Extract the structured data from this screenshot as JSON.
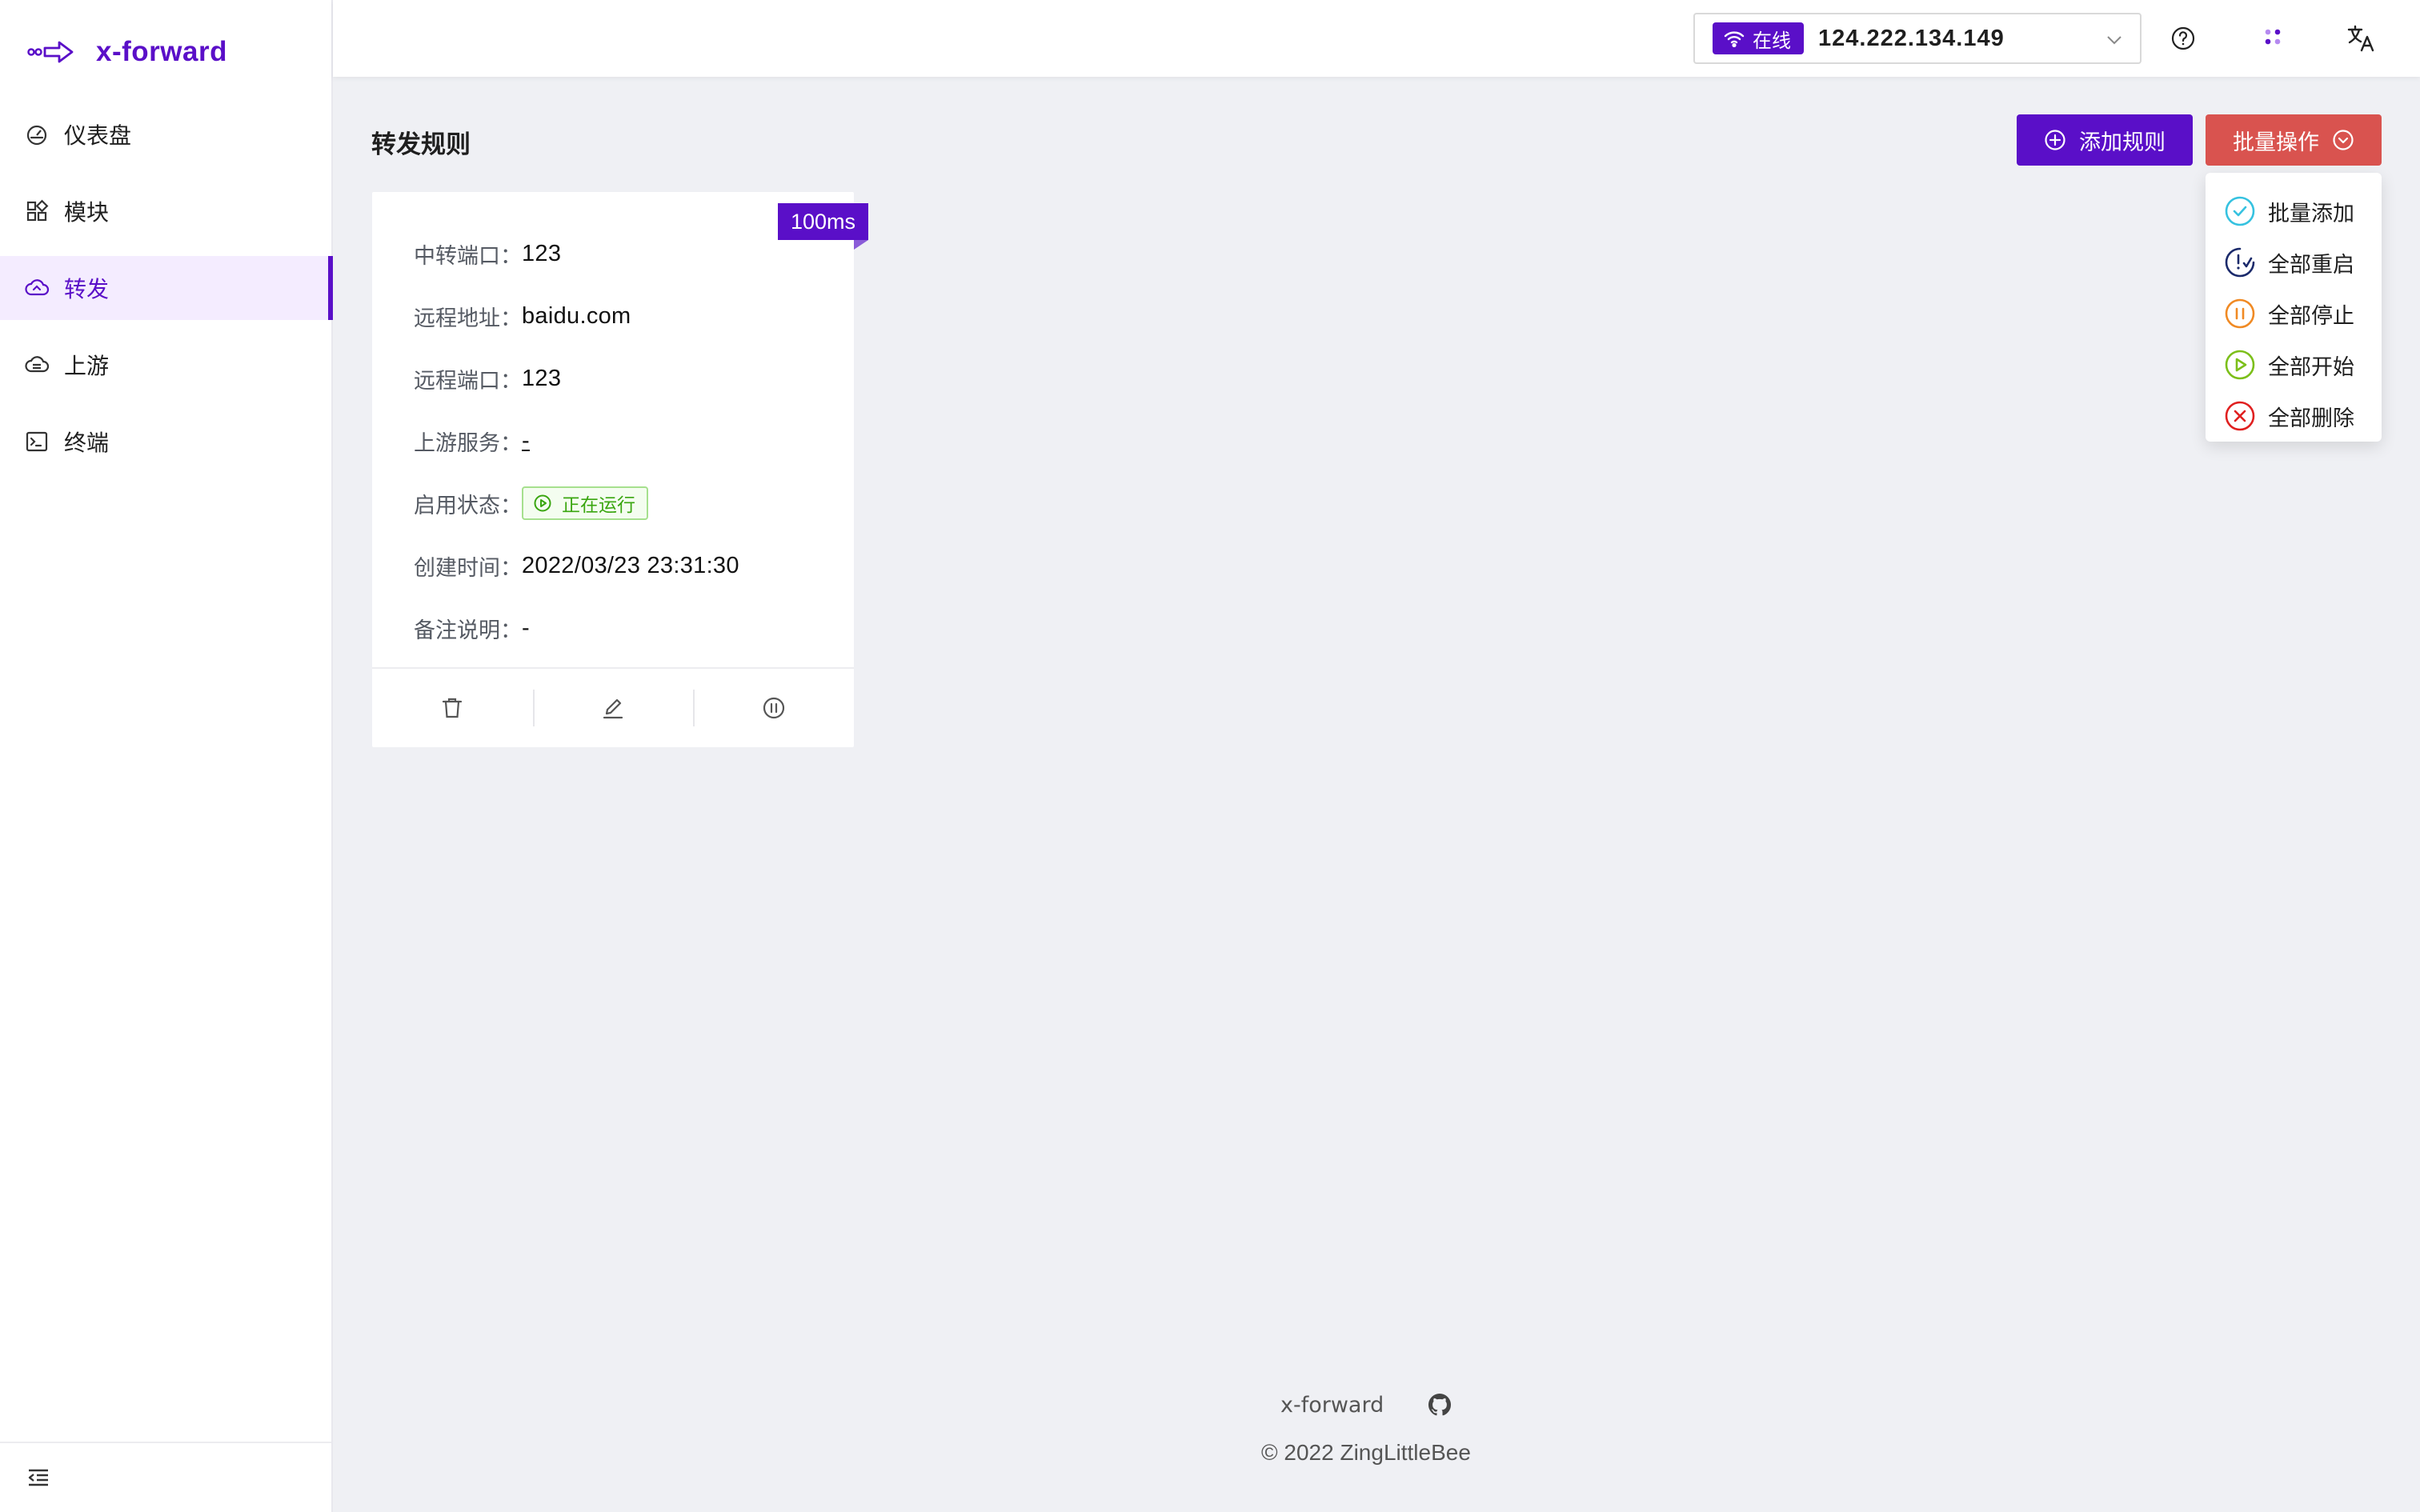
{
  "app": {
    "brand_name": "x-forward"
  },
  "sidebar": {
    "items": [
      {
        "label": "仪表盘",
        "icon": "dashboard-icon",
        "active": false
      },
      {
        "label": "模块",
        "icon": "modules-icon",
        "active": false
      },
      {
        "label": "转发",
        "icon": "forward-icon",
        "active": true
      },
      {
        "label": "上游",
        "icon": "upstream-icon",
        "active": false
      },
      {
        "label": "终端",
        "icon": "terminal-icon",
        "active": false
      }
    ],
    "collapse_icon": "collapse-icon"
  },
  "header": {
    "status_label": "在线",
    "server_ip": "124.222.134.149",
    "icons": [
      "help-icon",
      "theme-icon",
      "translate-icon"
    ]
  },
  "page": {
    "title": "转发规则",
    "add_button": "添加规则",
    "batch_button": "批量操作",
    "batch_menu": [
      {
        "label": "批量添加",
        "icon": "check-circle-icon",
        "color": "#36c2e0"
      },
      {
        "label": "全部重启",
        "icon": "restart-icon",
        "color": "#1b2a6b"
      },
      {
        "label": "全部停止",
        "icon": "pause-circle-icon",
        "color": "#f08a24"
      },
      {
        "label": "全部开始",
        "icon": "play-circle-icon",
        "color": "#7cbf1a"
      },
      {
        "label": "全部删除",
        "icon": "close-circle-icon",
        "color": "#e02020"
      }
    ]
  },
  "rule_card": {
    "latency": "100ms",
    "fields": {
      "relay_port_label": "中转端口：",
      "relay_port": "123",
      "remote_addr_label": "远程地址：",
      "remote_addr": "baidu.com",
      "remote_port_label": "远程端口：",
      "remote_port": "123",
      "upstream_label": "上游服务：",
      "upstream": "-",
      "status_label": "启用状态：",
      "status": "正在运行",
      "created_label": "创建时间：",
      "created": "2022/03/23 23:31:30",
      "note_label": "备注说明：",
      "note": "-"
    },
    "actions": [
      "delete-icon",
      "edit-icon",
      "pause-icon"
    ]
  },
  "footer": {
    "name": "x-forward",
    "copyright": "© 2022 ZingLittleBee"
  },
  "colors": {
    "primary": "#5a0fc8",
    "danger": "#d9534f",
    "success": "#3aa610",
    "background": "#eff0f4"
  }
}
